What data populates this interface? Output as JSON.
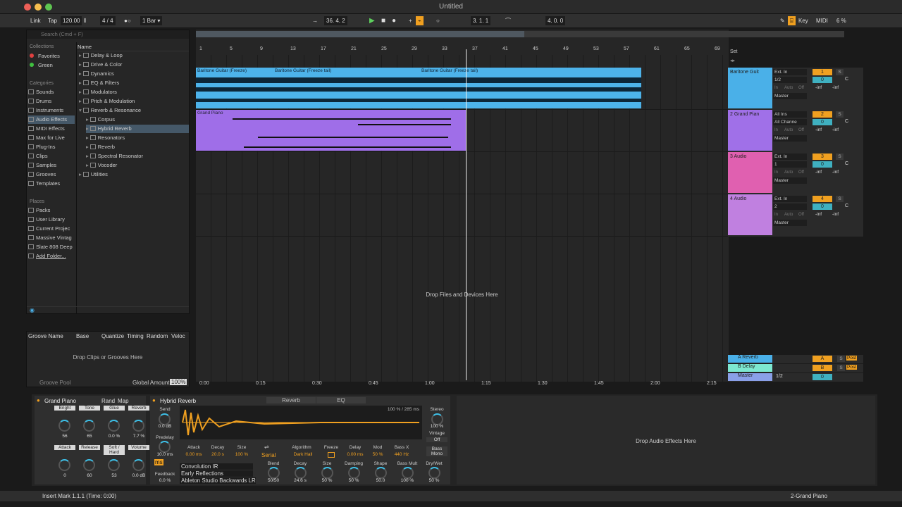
{
  "window": {
    "title": "Untitled"
  },
  "control_bar": {
    "link": "Link",
    "tap": "Tap",
    "tempo": "120.00",
    "signature": "4 / 4",
    "quantize": "1 Bar",
    "position": "36.  4.  2",
    "loop_start": "3.  1.  1",
    "loop_length": "4.  0.  0",
    "key": "Key",
    "midi": "MIDI",
    "cpu": "6 %"
  },
  "browser": {
    "collections_label": "Collections",
    "categories_label": "Categories",
    "places_label": "Places",
    "name_header": "Name",
    "search_placeholder": "Search (Cmd + F)",
    "collections": [
      {
        "label": "Favorites",
        "color": "#e04040"
      },
      {
        "label": "Green",
        "color": "#40c040"
      }
    ],
    "categories": [
      "Sounds",
      "Drums",
      "Instruments",
      "Audio Effects",
      "MIDI Effects",
      "Max for Live",
      "Plug-Ins",
      "Clips",
      "Samples",
      "Grooves",
      "Templates"
    ],
    "places": [
      "Packs",
      "User Library",
      "Current Projec",
      "Massive Vintag",
      "Slate 808 Deep",
      "Add Folder..."
    ],
    "items": [
      "Delay & Loop",
      "Drive & Color",
      "Dynamics",
      "EQ & Filters",
      "Modulators",
      "Pitch & Modulation",
      "Reverb & Resonance",
      "Corpus",
      "Hybrid Reverb",
      "Resonators",
      "Reverb",
      "Spectral Resonator",
      "Vocoder",
      "Utilities"
    ]
  },
  "groove_pool": {
    "headers": [
      "Groove Name",
      "Base",
      "Quantize",
      "Timing",
      "Random",
      "Veloc"
    ],
    "drop_text": "Drop Clips or Grooves Here",
    "footer": "Groove Pool",
    "global_amount_label": "Global Amount",
    "global_amount": "100%"
  },
  "arrangement": {
    "ruler": [
      "1",
      "5",
      "9",
      "13",
      "17",
      "21",
      "25",
      "29",
      "33",
      "37",
      "41",
      "45",
      "49",
      "53",
      "57",
      "61",
      "65",
      "69"
    ],
    "time_ruler": [
      "0:00",
      "0:15",
      "0:30",
      "0:45",
      "1:00",
      "1:15",
      "1:30",
      "1:45",
      "2:00",
      "2:15"
    ],
    "drop_text": "Drop Files and Devices Here",
    "clips": {
      "a": "Baritone Guitar (Freeze)",
      "b": "Baritone Guitar (Freeze tail)",
      "c": "Baritone Guitar (Freeze tail)",
      "d": "Grand Piano"
    }
  },
  "mixer": {
    "set": "Set",
    "tracks": [
      {
        "name": "Baritone Guit",
        "num": "1",
        "color": "#4ab0e8",
        "input": "Ext. In",
        "ch": "1/2",
        "out": "Master",
        "vol": "0",
        "pan": "C"
      },
      {
        "name": "2 Grand Pian",
        "num": "2",
        "color": "#a070e8",
        "input": "All Ins",
        "ch": "All Channe",
        "out": "Master",
        "vol": "0",
        "pan": "C"
      },
      {
        "name": "3 Audio",
        "num": "3",
        "color": "#e060b0",
        "input": "Ext. In",
        "ch": "1",
        "out": "Master",
        "vol": "0",
        "pan": "C"
      },
      {
        "name": "4 Audio",
        "num": "4",
        "color": "#c080e0",
        "input": "Ext. In",
        "ch": "2",
        "out": "Master",
        "vol": "0",
        "pan": "C"
      }
    ],
    "mon_in": "In",
    "mon_auto": "Auto",
    "mon_off": "Off",
    "inf": "-inf",
    "returns": [
      {
        "name": "A Reverb",
        "letter": "A"
      },
      {
        "name": "B Delay",
        "letter": "B"
      }
    ],
    "master": {
      "name": "Master",
      "ch": "1/2",
      "vol": "0"
    },
    "post": "Post",
    "s": "S"
  },
  "devices": {
    "grand_piano": {
      "title": "Grand Piano",
      "rand": "Rand",
      "map": "Map",
      "macros": [
        {
          "label": "Bright",
          "value": "56"
        },
        {
          "label": "Tone",
          "value": "65"
        },
        {
          "label": "Glue",
          "value": "0.0 %"
        },
        {
          "label": "Reverb",
          "value": "7.7 %"
        },
        {
          "label": "Attack",
          "value": "0"
        },
        {
          "label": "Release",
          "value": "60"
        },
        {
          "label": "Soft / Hard",
          "value": "53"
        },
        {
          "label": "Volume",
          "value": "0.0 dB"
        }
      ]
    },
    "hybrid_reverb": {
      "title": "Hybrid Reverb",
      "tab_reverb": "Reverb",
      "tab_eq": "EQ",
      "send_label": "Send",
      "send": "0.0 dB",
      "predelay_label": "Predelay",
      "predelay": "10.0 ms",
      "feedback_label": "Feedback",
      "feedback": "0.0 %",
      "ms": "ms",
      "ir_stats": "100 % / 285 ms",
      "env": [
        {
          "label": "Attack",
          "value": "0.00 ms"
        },
        {
          "label": "Decay",
          "value": "20.0 s"
        },
        {
          "label": "Size",
          "value": "100 %"
        }
      ],
      "routing": "Serial",
      "algorithm_label": "Algorithm",
      "algorithm": "Dark Hall",
      "freeze_label": "Freeze",
      "delay_label": "Delay",
      "delay": "0.00 ms",
      "mod_label": "Mod",
      "mod": "50 %",
      "bass_x_label": "Bass X",
      "bass_x": "440 Hz",
      "stereo_label": "Stereo",
      "stereo": "100 %",
      "vintage_label": "Vintage",
      "vintage": "Off",
      "bass_mono_label": "Bass Mono",
      "ir_type": "Convolution IR",
      "ir_category": "Early Reflections",
      "ir_name": "Ableton Studio Backwards LR",
      "knobs": [
        {
          "label": "Blend",
          "value": "50/50"
        },
        {
          "label": "Decay",
          "value": "24.6 s"
        },
        {
          "label": "Size",
          "value": "50 %"
        },
        {
          "label": "Damping",
          "value": "50 %"
        },
        {
          "label": "Shape",
          "value": "50.0"
        },
        {
          "label": "Bass Mult",
          "value": "100 %"
        },
        {
          "label": "Dry/Wet",
          "value": "50 %"
        }
      ]
    },
    "drop_text": "Drop Audio Effects Here"
  },
  "status": {
    "message": "Insert Mark 1.1.1 (Time: 0:00)",
    "track": "2-Grand Piano"
  }
}
